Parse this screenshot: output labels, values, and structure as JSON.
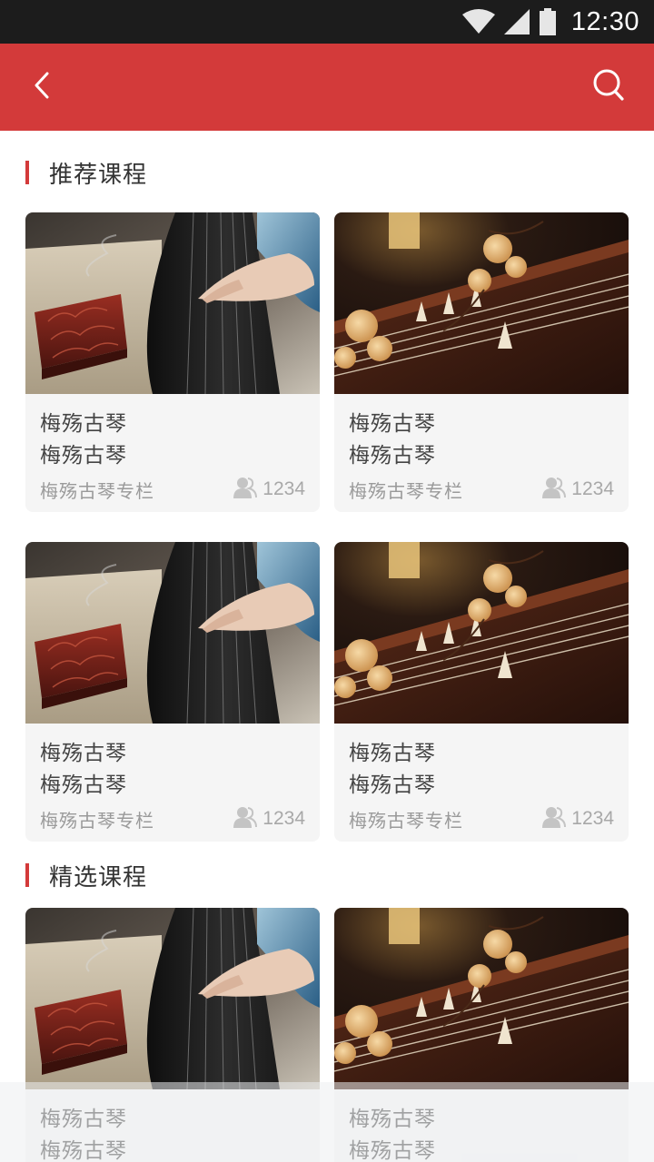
{
  "status_bar": {
    "time": "12:30",
    "icons": [
      "wifi-icon",
      "signal-icon",
      "battery-icon"
    ]
  },
  "app_bar": {
    "back_icon": "chevron-left-icon",
    "search_icon": "search-icon",
    "color": "#d33a3a"
  },
  "sections": [
    {
      "title": "推荐课程"
    },
    {
      "title": "精选课程"
    }
  ],
  "cards": [
    {
      "image": "guqin-hands-thumbnail",
      "line1": "梅殇古琴",
      "line2": "梅殇古琴",
      "column": "梅殇古琴专栏",
      "count": "1234"
    },
    {
      "image": "guqin-blossom-thumbnail",
      "line1": "梅殇古琴",
      "line2": "梅殇古琴",
      "column": "梅殇古琴专栏",
      "count": "1234"
    },
    {
      "image": "guqin-hands-thumbnail",
      "line1": "梅殇古琴",
      "line2": "梅殇古琴",
      "column": "梅殇古琴专栏",
      "count": "1234"
    },
    {
      "image": "guqin-blossom-thumbnail",
      "line1": "梅殇古琴",
      "line2": "梅殇古琴",
      "column": "梅殇古琴专栏",
      "count": "1234"
    },
    {
      "image": "guqin-hands-thumbnail",
      "line1": "梅殇古琴",
      "line2": "梅殇古琴"
    },
    {
      "image": "guqin-blossom-thumbnail",
      "line1": "梅殇古琴",
      "line2": "梅殇古琴"
    }
  ]
}
